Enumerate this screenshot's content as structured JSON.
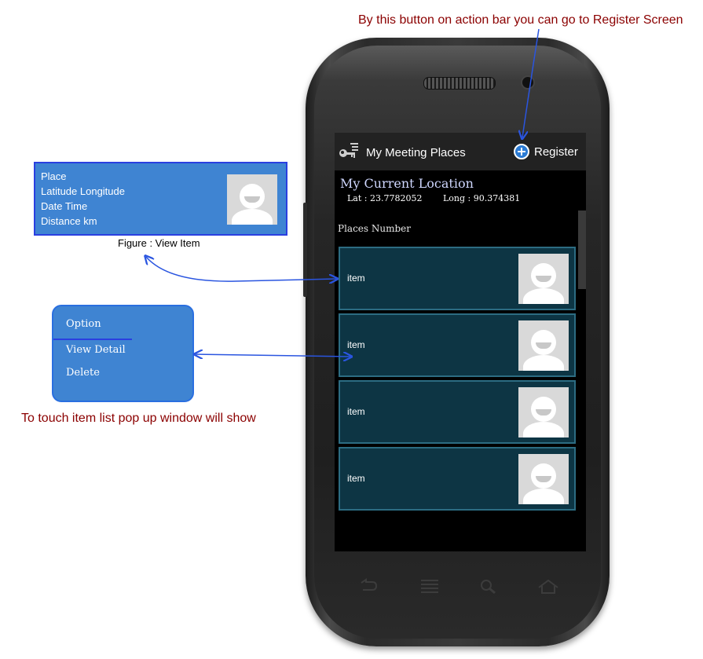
{
  "annotations": {
    "register_note": "By this button on action bar you can go to Register Screen",
    "popup_note": "To touch item list pop up window will show",
    "view_item_caption": "Figure : View Item"
  },
  "view_item": {
    "lines": [
      "Place",
      "Latitude Longitude",
      "Date Time",
      "Distance km"
    ]
  },
  "option_popup": {
    "title": "Option",
    "items": [
      "View Detail",
      "Delete"
    ]
  },
  "app": {
    "title": "My Meeting Places",
    "register_label": "Register",
    "current_location_heading": "My Current Location",
    "lat": "Lat : 23.7782052",
    "long": "Long : 90.374381",
    "places_heading": "Places Number",
    "items": [
      {
        "label": "item"
      },
      {
        "label": "item"
      },
      {
        "label": "item"
      },
      {
        "label": "item"
      }
    ]
  },
  "colors": {
    "annotation_text": "#8b0000",
    "arrow": "#2a55e0",
    "panel_blue": "#3f84d2",
    "item_bg": "#0d3544",
    "item_border": "#2c6c82"
  },
  "icons": [
    "key-menu-icon",
    "plus-circle-icon",
    "avatar-icon",
    "back-icon",
    "menu-icon",
    "search-icon",
    "home-icon"
  ]
}
